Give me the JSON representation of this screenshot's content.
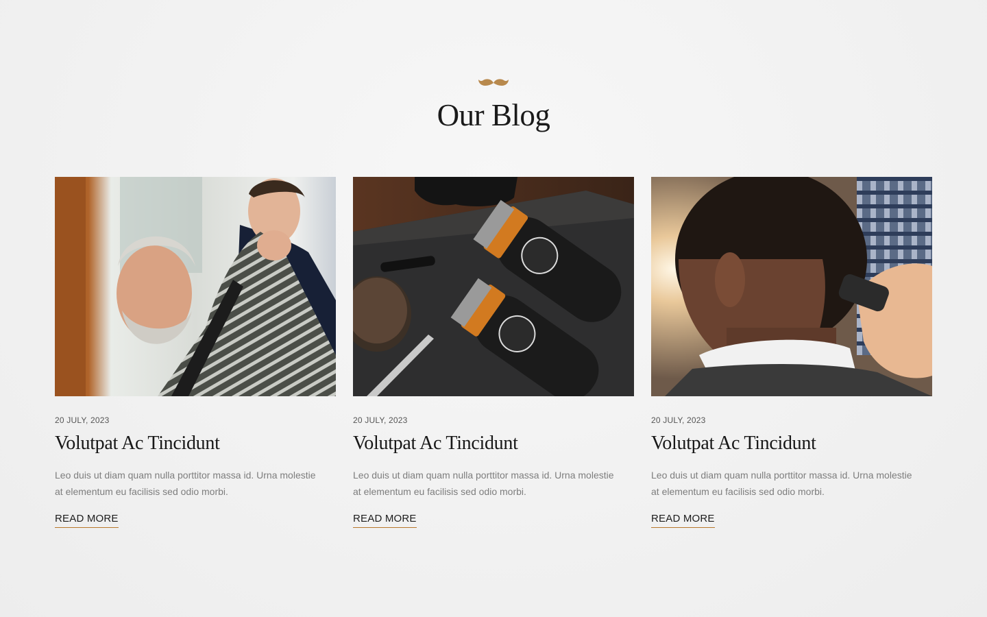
{
  "section": {
    "title": "Our Blog",
    "icon": "mustache-icon",
    "accent_color": "#b8894d"
  },
  "posts": [
    {
      "image": "barber-placing-cape-on-senior-man-photo",
      "date": "20 JULY, 2023",
      "title": "Volutpat Ac Tincidunt",
      "excerpt": "Leo duis ut diam quam nulla porttitor massa id. Urna molestie at elementum eu facilisis sed odio morbi.",
      "link_label": "READ MORE"
    },
    {
      "image": "hair-clippers-on-slate-photo",
      "date": "20 JULY, 2023",
      "title": "Volutpat Ac Tincidunt",
      "excerpt": "Leo duis ut diam quam nulla porttitor massa id. Urna molestie at elementum eu facilisis sed odio morbi.",
      "link_label": "READ MORE"
    },
    {
      "image": "man-getting-neck-trim-photo",
      "date": "20 JULY, 2023",
      "title": "Volutpat Ac Tincidunt",
      "excerpt": "Leo duis ut diam quam nulla porttitor massa id. Urna molestie at elementum eu facilisis sed odio morbi.",
      "link_label": "READ MORE"
    }
  ]
}
